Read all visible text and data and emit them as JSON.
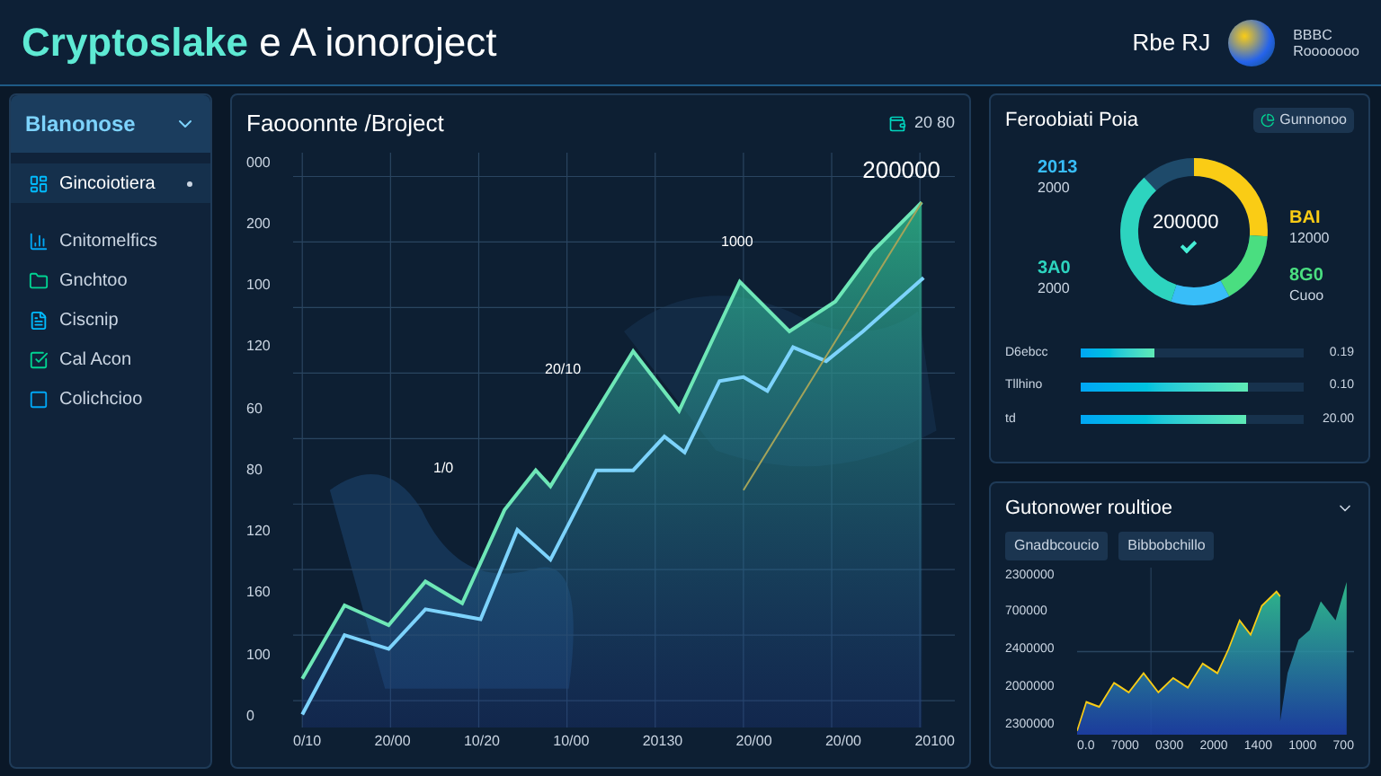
{
  "header": {
    "title_accent": "Cryptoslake",
    "title_rest": "e A ionoroject",
    "user_name": "Rbe RJ",
    "account_lines": [
      "BBBC",
      "Rooooooo"
    ]
  },
  "sidebar": {
    "heading": "Blanonose",
    "expanded": true,
    "items": [
      {
        "label": "Gincoiotiera",
        "selected": true
      },
      {
        "label": "Cnitomelfics",
        "selected": false
      },
      {
        "label": "Gnchtoo",
        "selected": false
      },
      {
        "label": "Ciscnip",
        "selected": false
      },
      {
        "label": "Cal Acon",
        "selected": false
      },
      {
        "label": "Colichcioo",
        "selected": false
      }
    ]
  },
  "main_chart": {
    "title": "Faooonnte /Broject",
    "badge": "20 80",
    "y_labels": [
      "000",
      "200",
      "100",
      "120",
      "60",
      "80",
      "120",
      "160",
      "100",
      "0"
    ],
    "x_labels": [
      "0/10",
      "20/00",
      "10/20",
      "10/00",
      "20130",
      "20/00",
      "20/00",
      "20100"
    ],
    "annotations": [
      "200000",
      "1000",
      "20/10",
      "1/0"
    ]
  },
  "portfolio": {
    "title": "Feroobiati Poia",
    "badge": "Gunnonoo",
    "center_value": "200000",
    "segments": [
      {
        "value": "2013",
        "label": "2000",
        "color": "#38bdf8"
      },
      {
        "value": "BAI",
        "label": "12000",
        "color": "#facc15"
      },
      {
        "value": "3A0",
        "label": "2000",
        "color": "#2dd4bf"
      },
      {
        "value": "8G0",
        "label": "Cuoo",
        "color": "#4ade80"
      }
    ],
    "bars": [
      {
        "label": "D6ebcc",
        "level": 0.33,
        "reading": "0.19"
      },
      {
        "label": "Tllhino",
        "level": 0.75,
        "reading": "0.10"
      },
      {
        "label": "td",
        "level": 0.74,
        "reading": "20.00"
      }
    ]
  },
  "bottom": {
    "title": "Gutonower roultioe",
    "buttons": [
      "Gnadbcoucio",
      "Bibbobchillo"
    ],
    "y_labels": [
      "2300000",
      "700000",
      "2400000",
      "2000000",
      "2300000"
    ],
    "x_labels": [
      "0.0",
      "7000",
      "0300",
      "2000",
      "1400",
      "1000",
      "700"
    ]
  }
}
